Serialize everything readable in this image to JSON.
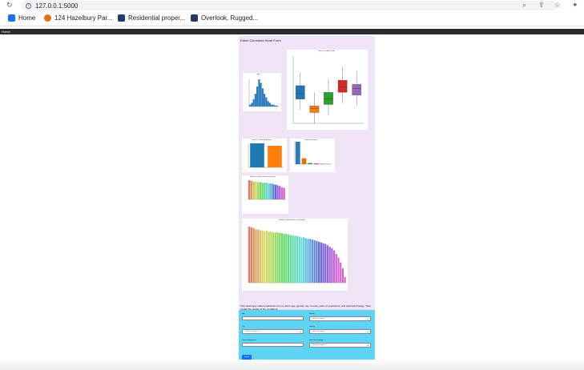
{
  "browser": {
    "url": "127.0.0.1:5000",
    "bookmarks": [
      {
        "label": "Home"
      },
      {
        "label": "124 Hazelbury Par..."
      },
      {
        "label": "Residential proper..."
      },
      {
        "label": "Overlook, Rugged..."
      }
    ]
  },
  "navbar": {
    "brand": "Home"
  },
  "page": {
    "title": "Edem Cleveland Heart Form",
    "description": "This Heart app makes predictions from a user's age, gender, city, country, years of experience, and selected strategy. Then predict the results of the conditions."
  },
  "charts": {
    "histogram": {
      "title": "Age"
    },
    "boxplot": {
      "title": "Age vs condition result"
    },
    "gender_bar": {
      "title": "Gender vs Strategy Average"
    },
    "count_bar": {
      "title": "Count per country"
    },
    "small_rainbow": {
      "title": "Number of observations per country"
    },
    "large_rainbow": {
      "title": "Number of observations per Strategy"
    }
  },
  "chart_data": [
    {
      "type": "bar",
      "title": "Age",
      "values": [
        2,
        4,
        8,
        14,
        22,
        30,
        26,
        20,
        14,
        10,
        6,
        4,
        2,
        2,
        1,
        1
      ]
    },
    {
      "type": "box",
      "title": "Age vs condition result",
      "series": [
        {
          "color": "#1f77b4",
          "q1": 48,
          "median": 52,
          "q3": 58
        },
        {
          "color": "#ff7f0e",
          "q1": 38,
          "median": 41,
          "q3": 43
        },
        {
          "color": "#2ca02c",
          "q1": 44,
          "median": 48,
          "q3": 53
        },
        {
          "color": "#d62728",
          "q1": 53,
          "median": 57,
          "q3": 62
        },
        {
          "color": "#9467bd",
          "q1": 51,
          "median": 56,
          "q3": 59
        }
      ]
    },
    {
      "type": "bar",
      "title": "Gender vs Strategy Average",
      "categories": [
        "Male",
        "Female"
      ],
      "values": [
        100,
        90
      ],
      "colors": [
        "#1f77b4",
        "#ff7f0e"
      ]
    },
    {
      "type": "bar",
      "title": "Count per country",
      "values": [
        100,
        26,
        5,
        3,
        2,
        1
      ]
    },
    {
      "type": "bar",
      "title": "Number of observations per country",
      "values": [
        30,
        29,
        28,
        28,
        27,
        27,
        26,
        26,
        26,
        25,
        25,
        24,
        23,
        22,
        21,
        19,
        18
      ]
    },
    {
      "type": "bar",
      "title": "Number of observations per Strategy",
      "values": [
        78,
        77,
        76,
        74,
        74,
        73,
        73,
        72,
        72,
        71,
        71,
        70,
        70,
        70,
        69,
        69,
        68,
        68,
        67,
        66,
        66,
        65,
        65,
        64,
        63,
        63,
        62,
        61,
        61,
        60,
        59,
        58,
        57,
        56,
        55,
        54,
        52,
        50,
        48,
        45,
        40,
        35,
        28,
        20,
        8
      ]
    }
  ],
  "form": {
    "age_label": "Age",
    "gender_label": "Gender",
    "city_label": "City",
    "country_label": "Country",
    "experience_label": "Years of Experience",
    "strategy_label": "Select the Strategy",
    "select_placeholder": "-- Select an option --",
    "submit_label": "Submit"
  },
  "colors": {
    "page_bg": "#f0e4f7",
    "form_bg": "#5fd3f3",
    "navbar": "#2b2b2b",
    "submit": "#0d6efd"
  }
}
